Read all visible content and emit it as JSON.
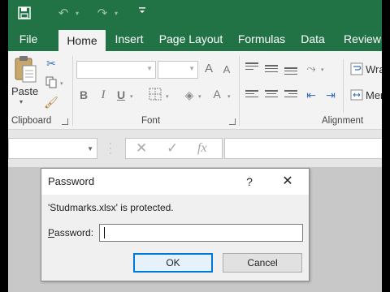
{
  "qat": {
    "icons": [
      "save-icon",
      "undo-icon",
      "redo-icon",
      "customize-icon"
    ]
  },
  "tabs": [
    {
      "label": "File"
    },
    {
      "label": "Home"
    },
    {
      "label": "Insert"
    },
    {
      "label": "Page Layout"
    },
    {
      "label": "Formulas"
    },
    {
      "label": "Data"
    },
    {
      "label": "Review"
    }
  ],
  "ribbon": {
    "clipboard": {
      "paste_label": "Paste",
      "group_label": "Clipboard"
    },
    "font": {
      "group_label": "Font",
      "bold": "B",
      "italic": "I",
      "underline": "U",
      "grow": "A",
      "shrink": "A",
      "font_color": "A"
    },
    "alignment": {
      "group_label": "Alignment",
      "wrap_label": "Wra",
      "merge_label": "Mer"
    }
  },
  "formula_bar": {
    "cancel_glyph": "✕",
    "enter_glyph": "✓",
    "fx_label": "fx"
  },
  "dialog": {
    "title": "Password",
    "help": "?",
    "close": "✕",
    "message": "'Studmarks.xlsx' is protected.",
    "password_label": "Password:",
    "password_value": "",
    "ok_label": "OK",
    "cancel_label": "Cancel"
  },
  "colors": {
    "excel_green": "#217346",
    "ribbon_bg": "#f3f3f3",
    "ok_border": "#0078d7"
  }
}
